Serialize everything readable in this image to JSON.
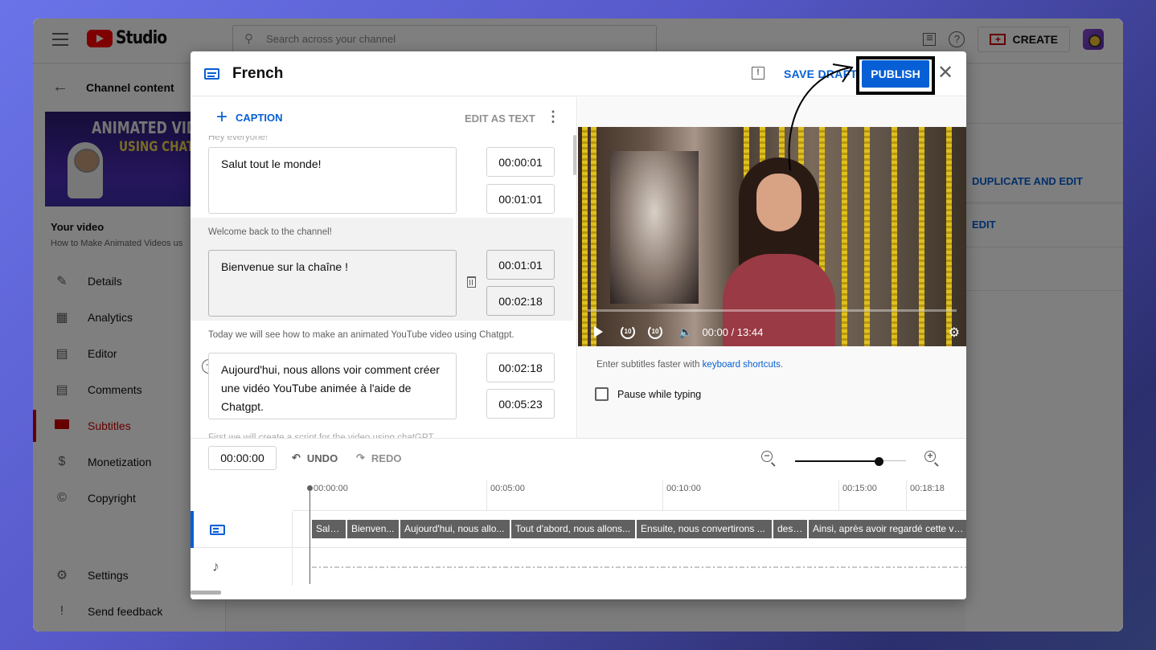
{
  "app": {
    "brand": "Studio",
    "search_placeholder": "Search across your channel",
    "create_label": "CREATE",
    "back_label": "Channel content",
    "thumbnail_line1": "ANIMATED VIDE",
    "thumbnail_line2": "USING CHAT G",
    "your_video_label": "Your video",
    "video_title": "How to Make Animated Videos us",
    "nav": [
      {
        "label": "Details",
        "icon": "pencil-icon",
        "active": false
      },
      {
        "label": "Analytics",
        "icon": "analytics-icon",
        "active": false
      },
      {
        "label": "Editor",
        "icon": "editor-icon",
        "active": false
      },
      {
        "label": "Comments",
        "icon": "comments-icon",
        "active": false
      },
      {
        "label": "Subtitles",
        "icon": "subtitles-icon",
        "active": true
      },
      {
        "label": "Monetization",
        "icon": "dollar-icon",
        "active": false
      },
      {
        "label": "Copyright",
        "icon": "copyright-icon",
        "active": false
      }
    ],
    "nav_bottom": [
      {
        "label": "Settings",
        "icon": "gear-icon"
      },
      {
        "label": "Send feedback",
        "icon": "feedback-icon"
      }
    ],
    "right_panel": {
      "duplicate_label": "DUPLICATE AND EDIT",
      "edit_label": "EDIT"
    }
  },
  "dialog": {
    "title": "French",
    "save_draft_label": "SAVE DRAFT",
    "publish_label": "PUBLISH",
    "close_glyph": "✕",
    "add_caption_label": "CAPTION",
    "edit_as_text_label": "EDIT AS TEXT",
    "captions": [
      {
        "original": "Hey everyone!",
        "text": "Salut tout le monde!",
        "start": "00:00:01",
        "end": "00:01:01"
      },
      {
        "original": "Welcome back to the channel!",
        "text": "Bienvenue sur la chaîne !",
        "start": "00:01:01",
        "end": "00:02:18"
      },
      {
        "original": "Today we will see how to make an animated YouTube video using Chatgpt.",
        "text": "Aujourd'hui, nous allons voir comment créer une vidéo YouTube animée à l'aide de Chatgpt.",
        "start": "00:02:18",
        "end": "00:05:23"
      },
      {
        "original": "First we will create a script for the video using chatGPT."
      }
    ],
    "player": {
      "time_display": "00:00 / 13:44",
      "progress": 0
    },
    "hint_prefix": "Enter subtitles faster with ",
    "hint_link": "keyboard shortcuts",
    "hint_suffix": ".",
    "pause_while_typing_label": "Pause while typing",
    "pause_while_typing_checked": false,
    "timeline": {
      "current_time": "00:00:00",
      "undo_label": "UNDO",
      "redo_label": "REDO",
      "zoom_level": 0.75,
      "ruler": [
        "00:00:00",
        "00:05:00",
        "00:10:00",
        "00:15:00",
        "00:18:18"
      ],
      "segments": [
        "Salu...",
        "Bienven...",
        "Aujourd'hui, nous allo...",
        "Tout d'abord, nous allons...",
        "Ensuite, nous convertirons ...",
        "des ...",
        "Ainsi, après avoir regardé cette vidéo"
      ]
    }
  },
  "colors": {
    "accent": "#065fd4",
    "brand_red": "#ff0000",
    "active_nav": "#cc0000"
  }
}
